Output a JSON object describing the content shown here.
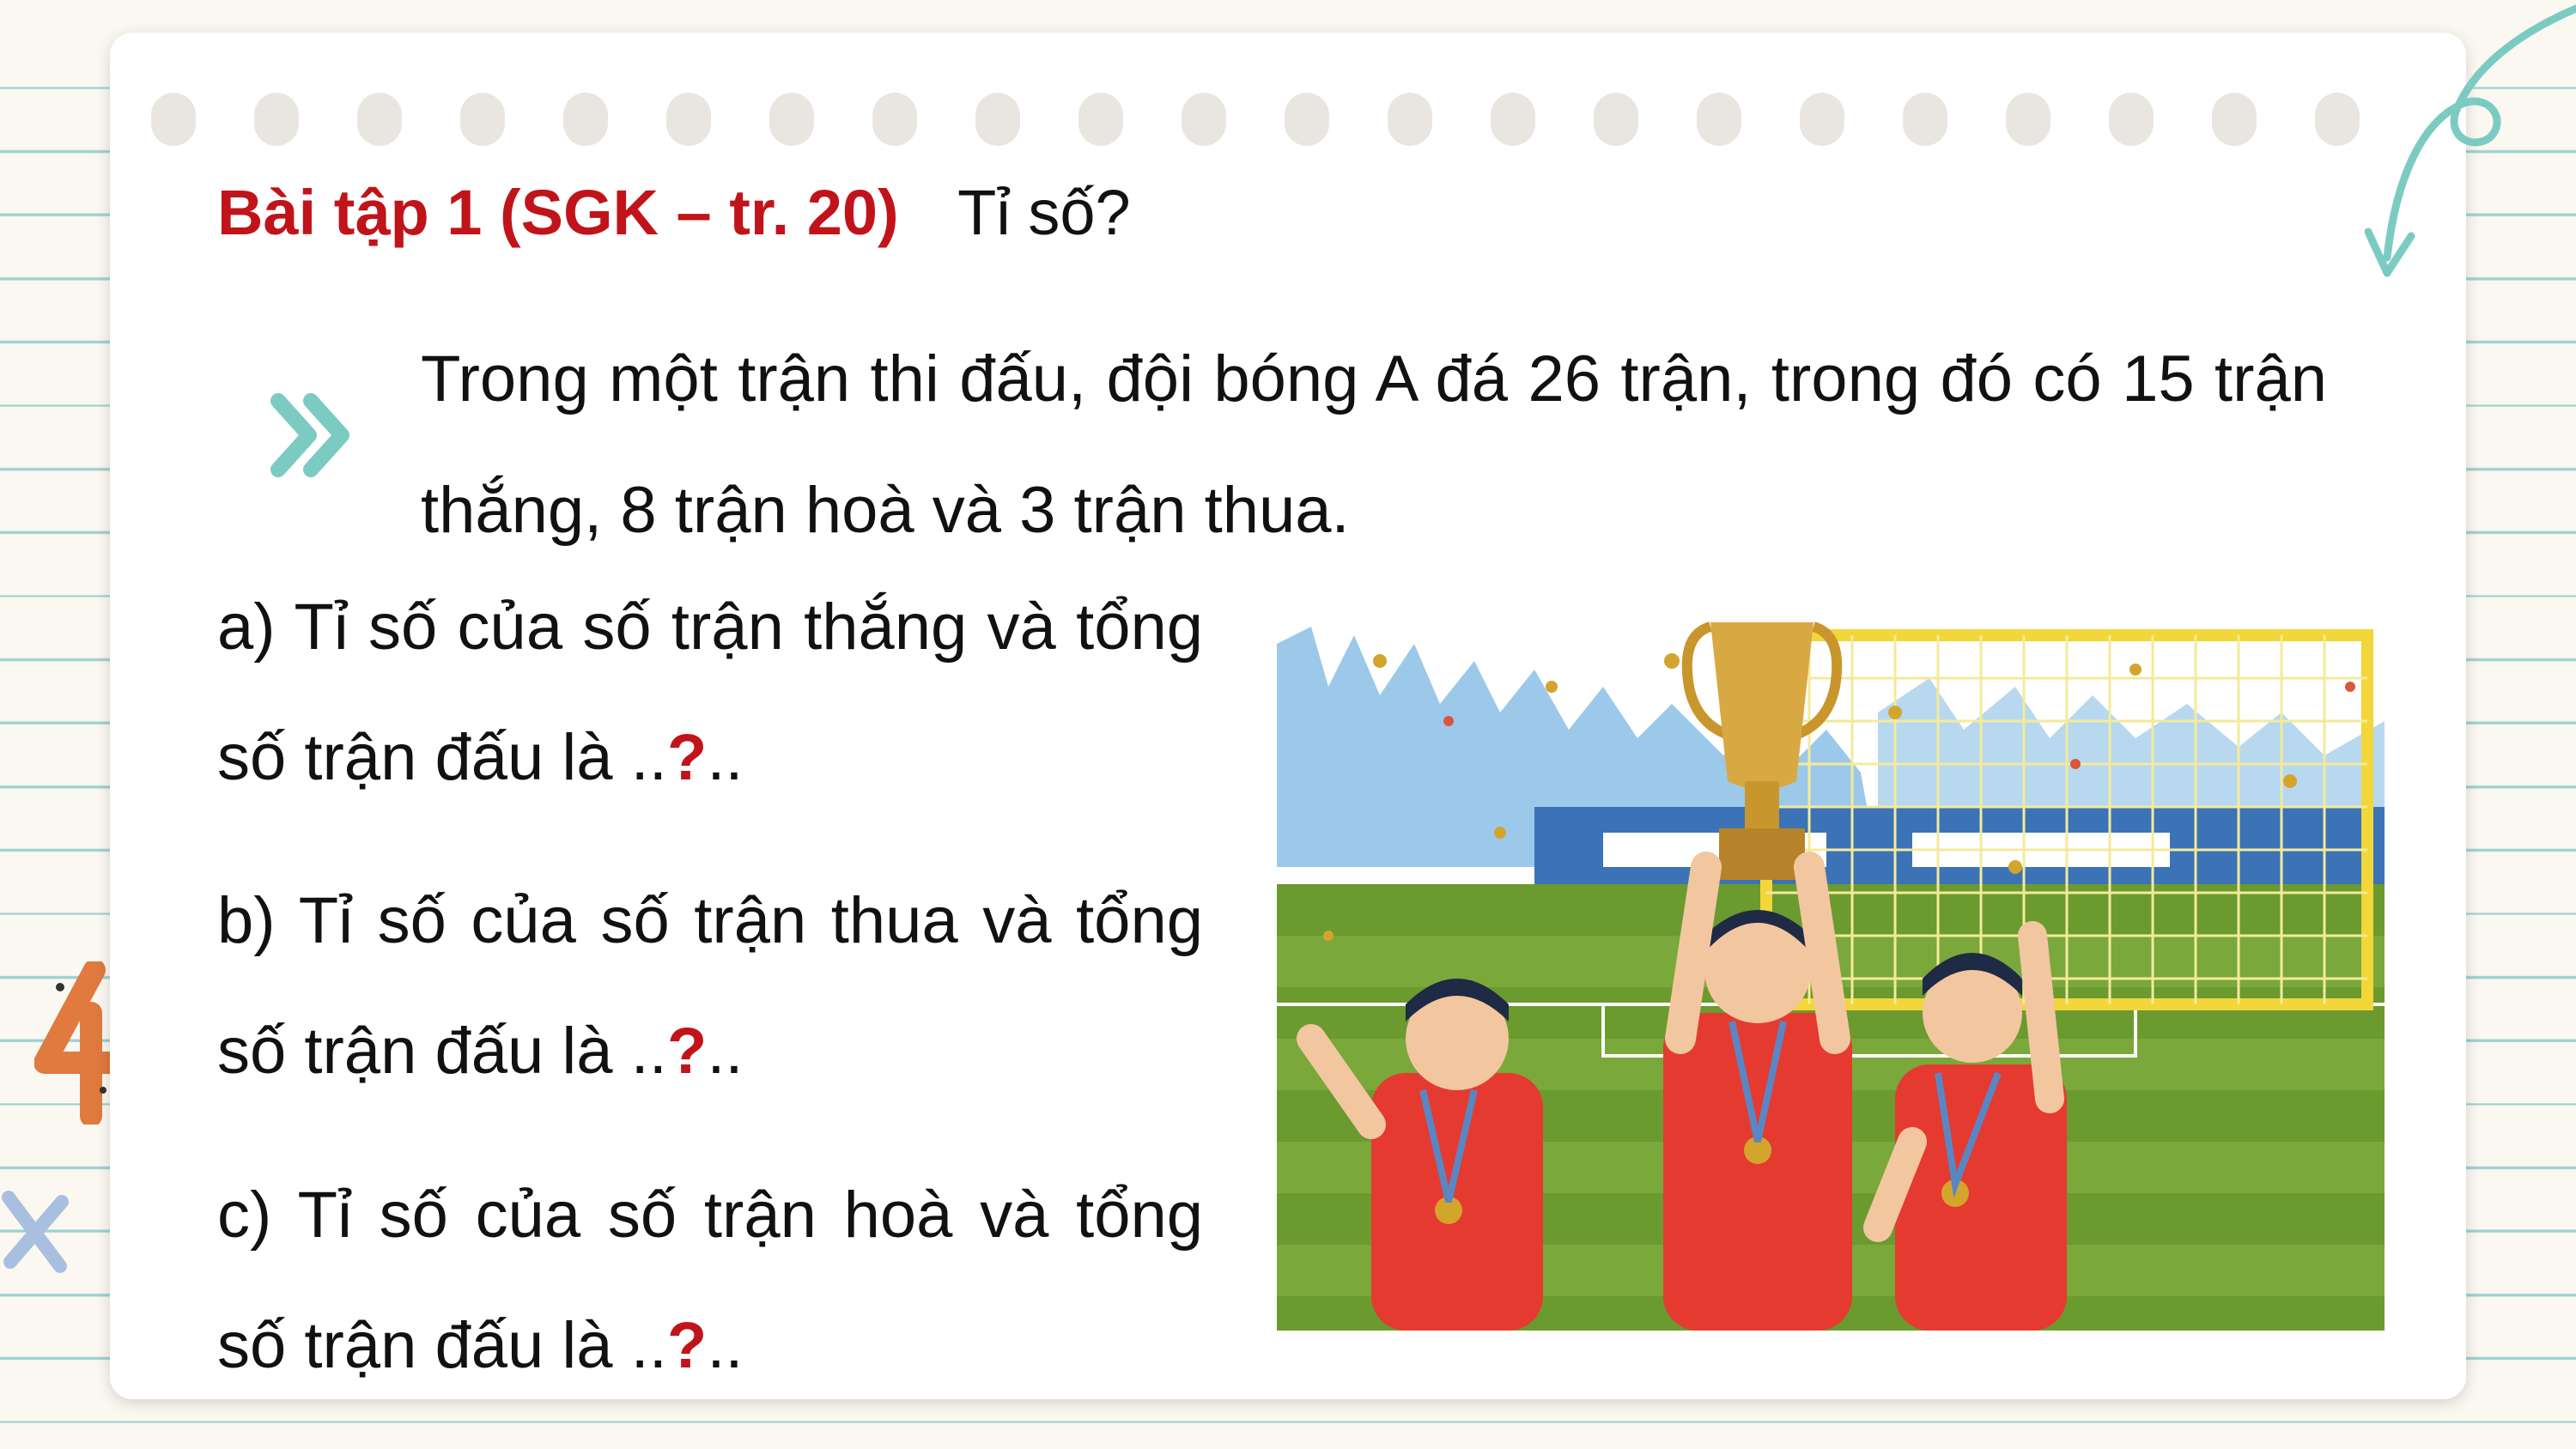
{
  "exercise": {
    "title": "Bài tập 1 (SGK – tr. 20)",
    "subtitle": "Tỉ số?",
    "intro": "Trong một trận thi đấu, đội bóng A đá 26 trận, trong đó có 15 trận thắng, 8 trận hoà và 3 trận thua."
  },
  "questions": [
    {
      "text": "a) Tỉ số của số trận thắng và tổng số trận đấu là ..",
      "mark": "?",
      "tail": ".."
    },
    {
      "text": "b) Tỉ số của số trận thua và tổng số trận đấu là ..",
      "mark": "?",
      "tail": ".."
    },
    {
      "text": "c) Tỉ số của số trận hoà và tổng số trận đấu là ..",
      "mark": "?",
      "tail": ".."
    }
  ],
  "colors": {
    "accent_red": "#c0141a",
    "teal": "#7ccbc3",
    "line": "#9dd2cf"
  },
  "icons": [
    "double-chevron-icon",
    "swirl-arrow-icon",
    "cross-icon",
    "number-4-icon"
  ],
  "illustration": "football-team-trophy-celebration"
}
